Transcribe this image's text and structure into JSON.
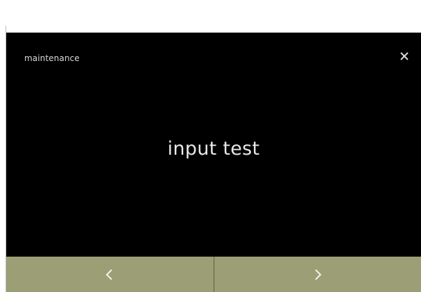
{
  "header": {
    "title": "maintenance",
    "close_icon": "close-icon"
  },
  "main": {
    "label": "input test"
  },
  "nav": {
    "prev_icon": "chevron-left-icon",
    "next_icon": "chevron-right-icon"
  },
  "colors": {
    "screen_background": "#000000",
    "nav_bar": "#9c9e75",
    "text": "#e8e8e8"
  }
}
